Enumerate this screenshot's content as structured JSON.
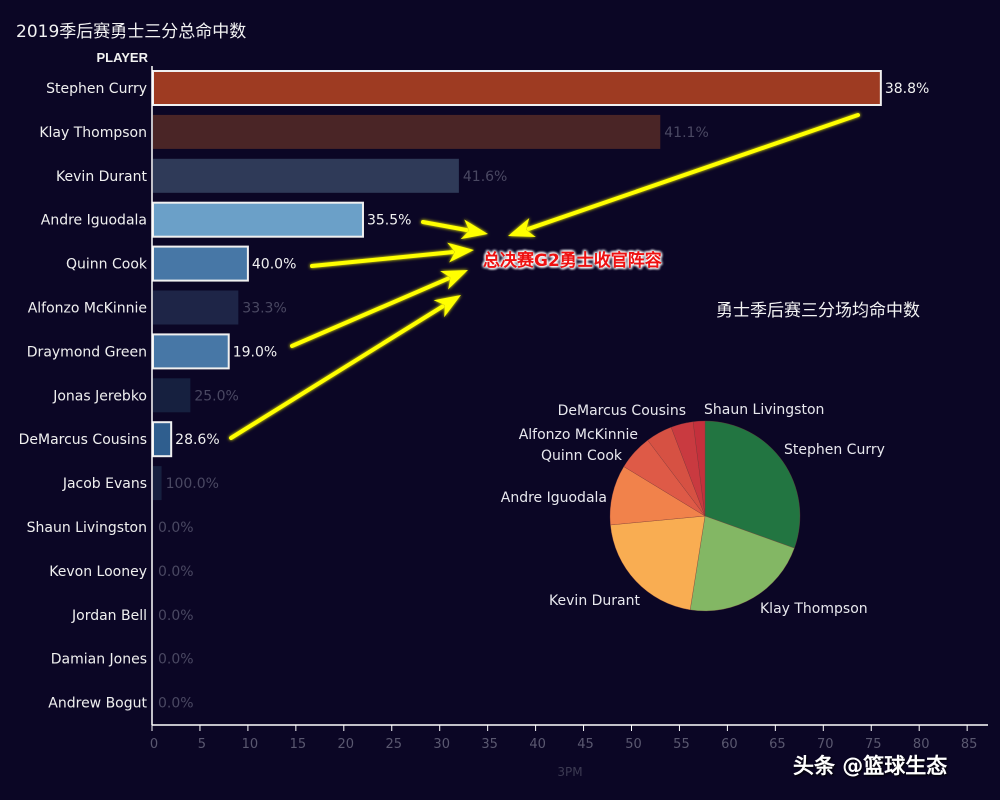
{
  "chart_data": [
    {
      "type": "bar",
      "orientation": "horizontal",
      "title": "2019季后赛勇士三分总命中数",
      "row_header": "PLAYER",
      "xlabel": "3PM",
      "ylabel": "PLAYER",
      "xlim": [
        0,
        87
      ],
      "x_ticks": [
        "0",
        "5",
        "10",
        "15",
        "20",
        "25",
        "30",
        "35",
        "40",
        "45",
        "50",
        "55",
        "60",
        "65",
        "70",
        "75",
        "80",
        "85"
      ],
      "grid": false,
      "categories": [
        "Stephen Curry",
        "Klay Thompson",
        "Kevin Durant",
        "Andre Iguodala",
        "Quinn Cook",
        "Alfonzo McKinnie",
        "Draymond Green",
        "Jonas Jerebko",
        "DeMarcus Cousins",
        "Jacob Evans",
        "Shaun Livingston",
        "Kevon Looney",
        "Jordan Bell",
        "Damian Jones",
        "Andrew Bogut"
      ],
      "values": [
        76,
        53,
        32,
        22,
        10,
        9,
        8,
        4,
        2,
        1,
        0,
        0,
        0,
        0,
        0
      ],
      "labels": [
        "38.8%",
        "41.1%",
        "41.6%",
        "35.5%",
        "40.0%",
        "33.3%",
        "19.0%",
        "25.0%",
        "28.6%",
        "100.0%",
        "0.0%",
        "0.0%",
        "0.0%",
        "0.0%",
        "0.0%"
      ],
      "highlighted": [
        true,
        false,
        false,
        true,
        true,
        false,
        true,
        false,
        true,
        false,
        false,
        false,
        false,
        false,
        false
      ],
      "colors": [
        "#9e3b22",
        "#4a2526",
        "#2f3a58",
        "#6ba0c8",
        "#4777a6",
        "#1e2547",
        "#4777a6",
        "#16203f",
        "#2f5e8e",
        "#16203f",
        "#0b0625",
        "#0b0625",
        "#0b0625",
        "#0b0625",
        "#0b0625"
      ]
    },
    {
      "type": "pie",
      "title": "勇士季后赛三分场均命中数",
      "categories": [
        "Stephen Curry",
        "Klay Thompson",
        "Kevin Durant",
        "Andre Iguodala",
        "Quinn Cook",
        "Alfonzo McKinnie",
        "DeMarcus Cousins",
        "Shaun Livingston"
      ],
      "values": [
        30.5,
        22.0,
        21.0,
        10.2,
        6.0,
        4.5,
        3.8,
        2.0
      ],
      "colors": [
        "#227541",
        "#83b764",
        "#f9ad52",
        "#f1824b",
        "#de5a47",
        "#d65143",
        "#c93a40",
        "#c4303c"
      ],
      "labels_shown": [
        "Stephen Curry",
        "Klay Thompson",
        "Kevin Durant",
        "Andre Iguodala",
        "Quinn Cook",
        "Alfonzo McKinnie",
        "DeMarcus Cousins",
        "Shaun Livingston"
      ]
    }
  ],
  "annotation": {
    "text": "总决赛G2勇士收官阵容",
    "arrow_color": "#ffff00",
    "text_color": "#ee1111"
  },
  "watermark": "头条 @篮球生态",
  "colors": {
    "background": "#0b0625",
    "highlight_label": "#f0f0f0",
    "dim_label": "#4a4862"
  }
}
